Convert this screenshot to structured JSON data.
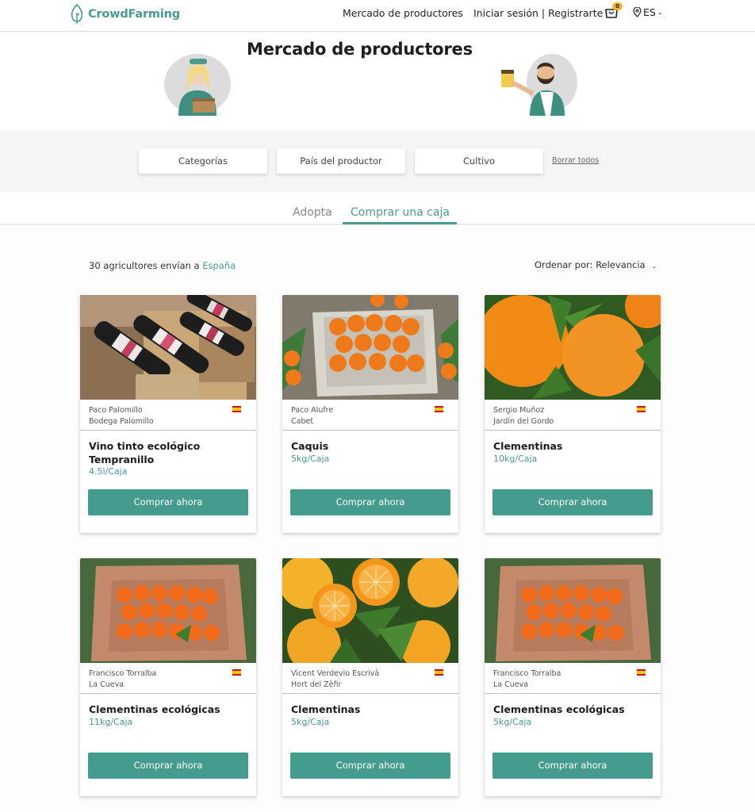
{
  "header": {
    "brand": "CrowdFarming",
    "nav_market": "Mercado de productores",
    "nav_login": "Iniciar sesión | Registrarte",
    "cart_count": "0",
    "language": "ES"
  },
  "hero": {
    "title": "Mercado de productores"
  },
  "filters": {
    "categories": "Categorías",
    "producer_country": "País del productor",
    "crop": "Cultivo",
    "clear_all": "Borrar todos"
  },
  "tabs": {
    "adopt": "Adopta",
    "buy_box": "Comprar una caja",
    "active": "buy_box"
  },
  "listing": {
    "count_text": "30 agricultores envían a",
    "country": "España",
    "sort_label": "Ordenar por: Relevancia"
  },
  "products": [
    {
      "farmer": "Paco Palomillo",
      "farm": "Bodega Palomillo",
      "title": "Vino tinto ecológico Tempranillo",
      "size": "4.5l/Caja",
      "button": "Comprar ahora",
      "image": "wine-bottles"
    },
    {
      "farmer": "Paco Alufre",
      "farm": "Cabet",
      "title": "Caquis",
      "size": "5kg/Caja",
      "button": "Comprar ahora",
      "image": "persimmon-box"
    },
    {
      "farmer": "Sergio Muñoz",
      "farm": "Jardín del Gordo",
      "title": "Clementinas",
      "size": "10kg/Caja",
      "button": "Comprar ahora",
      "image": "clementines-closeup"
    },
    {
      "farmer": "Francisco Torralba",
      "farm": "La Cueva",
      "title": "Clementinas ecológicas",
      "size": "11kg/Caja",
      "button": "Comprar ahora",
      "image": "clementine-box"
    },
    {
      "farmer": "Vicent Verdevio Escrivà",
      "farm": "Hort del Zèfir",
      "title": "Clementinas",
      "size": "5kg/Caja",
      "button": "Comprar ahora",
      "image": "clementines-halved"
    },
    {
      "farmer": "Francisco Torralba",
      "farm": "La Cueva",
      "title": "Clementinas ecológicas",
      "size": "5kg/Caja",
      "button": "Comprar ahora",
      "image": "clementine-box"
    }
  ],
  "colors": {
    "brand": "#4a9a8e",
    "button": "#459b8e",
    "badge": "#f2b330"
  }
}
